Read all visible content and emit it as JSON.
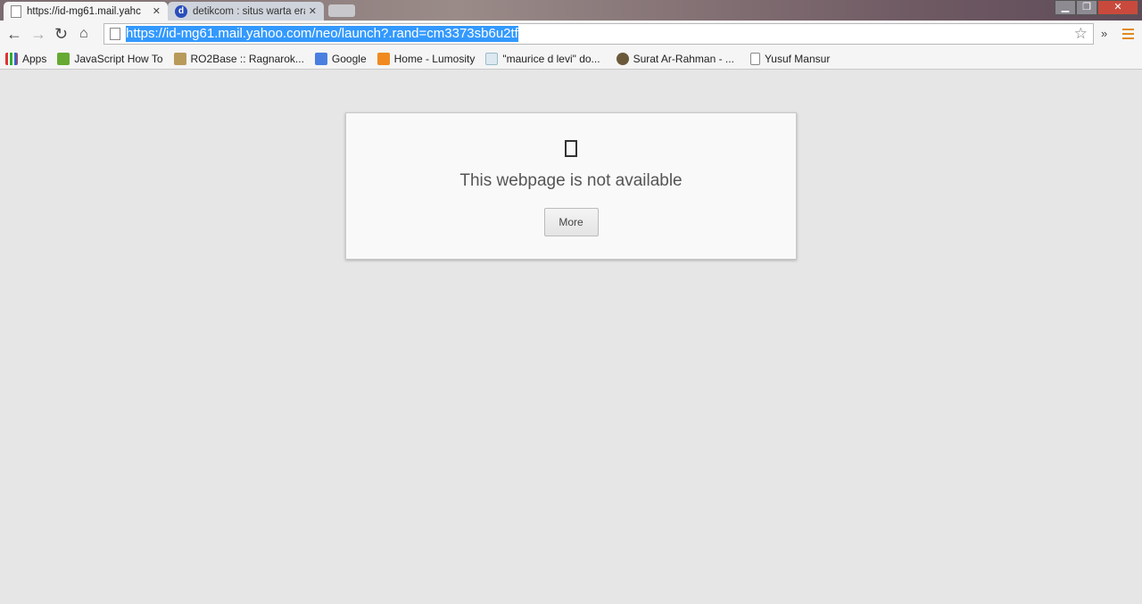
{
  "tabs": [
    {
      "title": "https://id-mg61.mail.yahoo.com/neo/launch?.rand=cm3373sb6u2tf",
      "display": "https://id-mg61.mail.yahc",
      "active": true
    },
    {
      "title": "detikcom : situs warta era",
      "display": "detikcom : situs warta era",
      "active": false
    }
  ],
  "toolbar": {
    "url": "https://id-mg61.mail.yahoo.com/neo/launch?.rand=cm3373sb6u2tf"
  },
  "bookmarks": [
    {
      "label": "Apps",
      "icon": "apps-grid-icon"
    },
    {
      "label": "JavaScript How To",
      "icon": "w3schools-icon"
    },
    {
      "label": "RO2Base :: Ragnarok...",
      "icon": "ro2base-icon"
    },
    {
      "label": "Google",
      "icon": "google-icon"
    },
    {
      "label": "Home - Lumosity",
      "icon": "lumosity-icon"
    },
    {
      "label": "\"maurice d levi\" do...",
      "icon": "bf-icon"
    },
    {
      "label": "Surat Ar-Rahman - ...",
      "icon": "quran-icon"
    },
    {
      "label": "Yusuf Mansur",
      "icon": "page-icon"
    }
  ],
  "error": {
    "message": "This webpage is not available",
    "more_label": "More"
  },
  "colors": {
    "selection": "#3399ff",
    "menu": "#e08a1e"
  }
}
